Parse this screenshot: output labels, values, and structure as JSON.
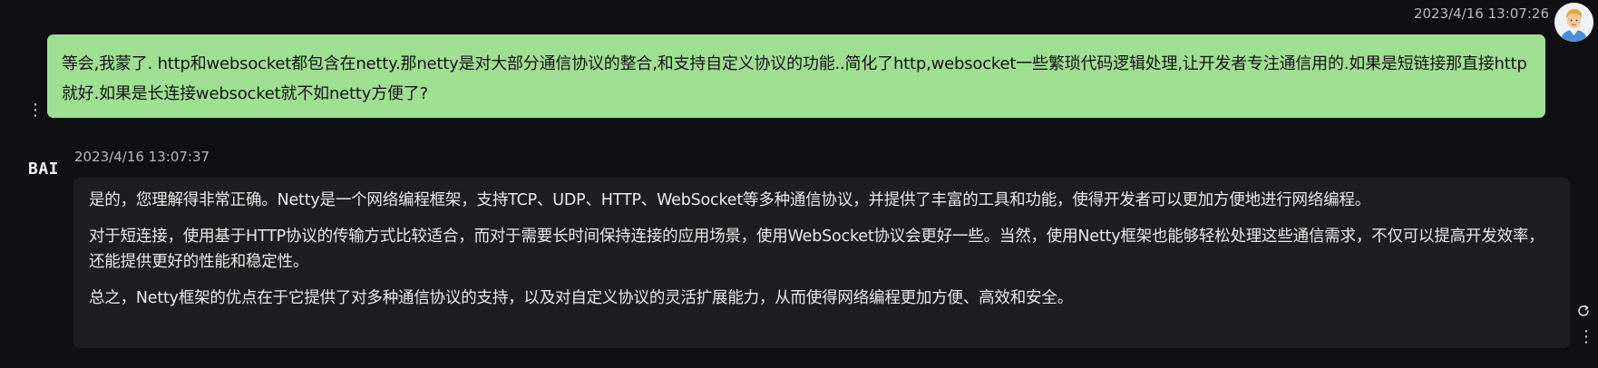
{
  "user_message": {
    "timestamp": "2023/4/16 13:07:26",
    "text": "等会,我蒙了. http和websocket都包含在netty.那netty是对大部分通信协议的整合,和支持自定义协议的功能..简化了http,websocket一些繁琐代码逻辑处理,让开发者专注通信用的.如果是短链接那直接http就好.如果是长连接websocket就不如netty方便了?",
    "bubble_color": "#9fdf92",
    "more_icon": "vertical-ellipsis"
  },
  "ai_message": {
    "logo_text": "BAI",
    "timestamp": "2023/4/16 13:07:37",
    "paragraphs": [
      "是的，您理解得非常正确。Netty是一个网络编程框架，支持TCP、UDP、HTTP、WebSocket等多种通信协议，并提供了丰富的工具和功能，使得开发者可以更加方便地进行网络编程。",
      "对于短连接，使用基于HTTP协议的传输方式比较适合，而对于需要长时间保持连接的应用场景，使用WebSocket协议会更好一些。当然，使用Netty框架也能够轻松处理这些通信需求，不仅可以提高开发效率，还能提供更好的性能和稳定性。",
      "总之，Netty框架的优点在于它提供了对多种通信协议的支持，以及对自定义协议的灵活扩展能力，从而使得网络编程更加方便、高效和安全。"
    ],
    "bubble_color": "#1e1e21",
    "refresh_icon": "refresh",
    "more_icon": "vertical-ellipsis"
  }
}
